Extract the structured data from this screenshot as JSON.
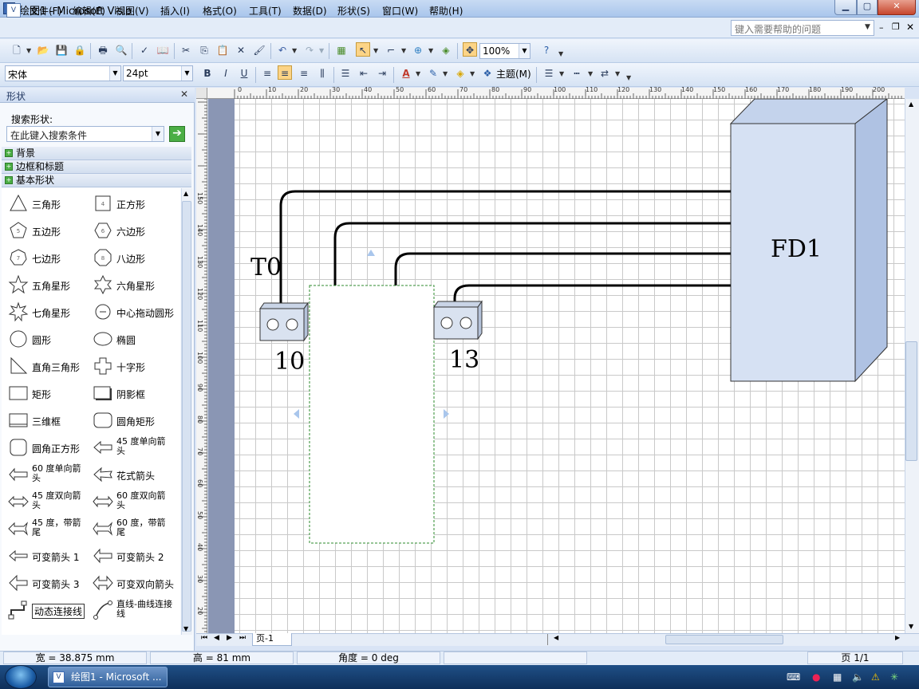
{
  "window": {
    "title": "绘图1 - Microsoft Visio",
    "app_icon": "visio-icon",
    "minimize": "▁",
    "maximize": "▢",
    "close": "✕"
  },
  "menu": {
    "items": [
      "文件(F)",
      "编辑(E)",
      "视图(V)",
      "插入(I)",
      "格式(O)",
      "工具(T)",
      "数据(D)",
      "形状(S)",
      "窗口(W)",
      "帮助(H)"
    ],
    "help_placeholder": "键入需要帮助的问题"
  },
  "toolbar": {
    "zoom": "100%",
    "font": "宋体",
    "font_size": "24pt",
    "theme_label": "主题(M)"
  },
  "shapes_panel": {
    "title": "形状",
    "search_label": "搜索形状:",
    "search_placeholder": "在此键入搜索条件",
    "stencils": [
      "背景",
      "边框和标题",
      "基本形状"
    ],
    "items": [
      {
        "label": "三角形",
        "icon": "triangle-icon"
      },
      {
        "label": "正方形",
        "icon": "square-icon"
      },
      {
        "label": "五边形",
        "icon": "pentagon-icon"
      },
      {
        "label": "六边形",
        "icon": "hexagon-icon"
      },
      {
        "label": "七边形",
        "icon": "heptagon-icon"
      },
      {
        "label": "八边形",
        "icon": "octagon-icon"
      },
      {
        "label": "五角星形",
        "icon": "five-point-star-icon"
      },
      {
        "label": "六角星形",
        "icon": "six-point-star-icon"
      },
      {
        "label": "七角星形",
        "icon": "seven-point-star-icon"
      },
      {
        "label": "中心拖动圆形",
        "icon": "center-drag-circle-icon"
      },
      {
        "label": "圆形",
        "icon": "circle-icon"
      },
      {
        "label": "椭圆",
        "icon": "ellipse-icon"
      },
      {
        "label": "直角三角形",
        "icon": "right-triangle-icon"
      },
      {
        "label": "十字形",
        "icon": "cross-icon"
      },
      {
        "label": "矩形",
        "icon": "rectangle-icon"
      },
      {
        "label": "阴影框",
        "icon": "shadow-box-icon"
      },
      {
        "label": "三维框",
        "icon": "3d-box-icon"
      },
      {
        "label": "圆角矩形",
        "icon": "rounded-rectangle-icon"
      },
      {
        "label": "圆角正方形",
        "icon": "rounded-square-icon"
      },
      {
        "label": "45 度单向箭头",
        "icon": "arrow-45-single-icon"
      },
      {
        "label": "60 度单向箭头",
        "icon": "arrow-60-single-icon"
      },
      {
        "label": "花式箭头",
        "icon": "fancy-arrow-icon"
      },
      {
        "label": "45 度双向箭头",
        "icon": "arrow-45-double-icon"
      },
      {
        "label": "60 度双向箭头",
        "icon": "arrow-60-double-icon"
      },
      {
        "label": "45 度，带箭尾",
        "icon": "arrow-45-tail-icon"
      },
      {
        "label": "60 度，带箭尾",
        "icon": "arrow-60-tail-icon"
      },
      {
        "label": "可变箭头 1",
        "icon": "flexi-arrow-1-icon"
      },
      {
        "label": "可变箭头 2",
        "icon": "flexi-arrow-2-icon"
      },
      {
        "label": "可变箭头 3",
        "icon": "flexi-arrow-3-icon"
      },
      {
        "label": "可变双向箭头",
        "icon": "flexi-double-arrow-icon"
      },
      {
        "label": "动态连接线",
        "icon": "dynamic-connector-icon"
      },
      {
        "label": "直线-曲线连接线",
        "icon": "line-curve-connector-icon"
      }
    ]
  },
  "ruler": {
    "top_labels": [
      "0",
      "10",
      "20",
      "30",
      "40",
      "50",
      "60",
      "70",
      "80",
      "90",
      "100",
      "110",
      "120",
      "130",
      "140",
      "150",
      "160",
      "170",
      "180",
      "190",
      "200"
    ],
    "left_labels": [
      "150",
      "140",
      "130",
      "120",
      "110",
      "100",
      "90",
      "80",
      "70",
      "60",
      "50",
      "40",
      "30",
      "20",
      "10"
    ]
  },
  "drawing": {
    "label_t0": "T0",
    "label_10": "10",
    "label_13": "13",
    "label_fd1": "FD1"
  },
  "page_tab": "页-1",
  "status": {
    "width": "宽 = 38.875 mm",
    "height": "高 = 81 mm",
    "angle": "角度 = 0 deg",
    "page": "页 1/1"
  },
  "taskbar": {
    "task_label": "绘图1 - Microsoft ..."
  }
}
